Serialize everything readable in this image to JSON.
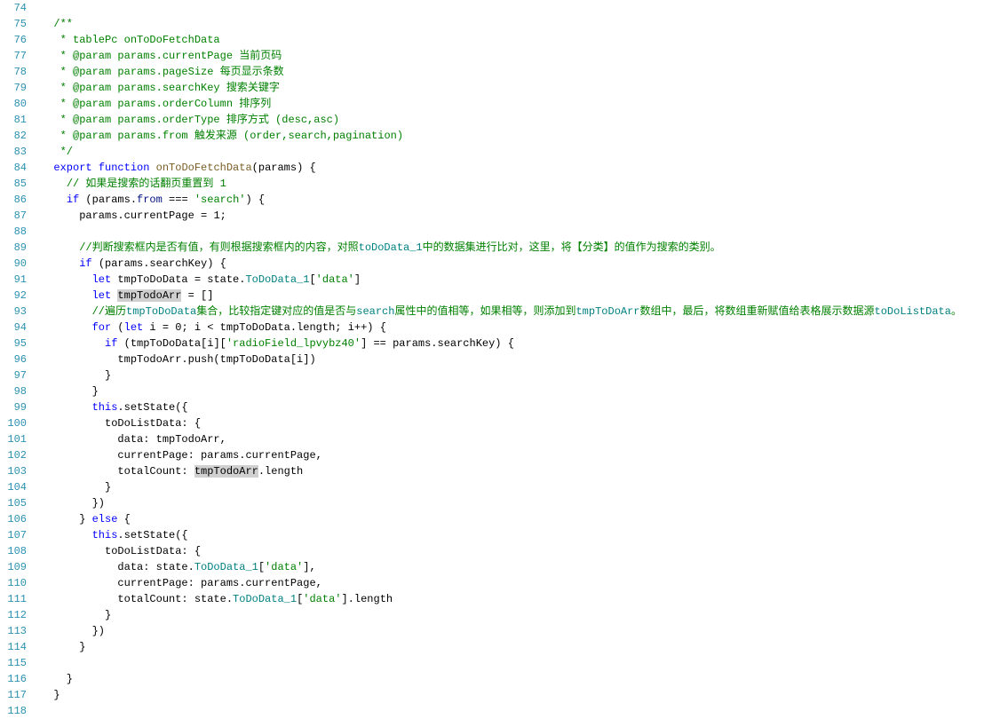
{
  "startLine": 74,
  "endLine": 118,
  "lines": [
    {
      "n": 74,
      "segs": []
    },
    {
      "n": 75,
      "segs": [
        {
          "t": "  ",
          "c": "plain"
        },
        {
          "t": "/**",
          "c": "comment"
        }
      ]
    },
    {
      "n": 76,
      "segs": [
        {
          "t": "   * tablePc onToDoFetchData",
          "c": "comment"
        }
      ]
    },
    {
      "n": 77,
      "segs": [
        {
          "t": "   * @param params.currentPage 当前页码",
          "c": "comment"
        }
      ]
    },
    {
      "n": 78,
      "segs": [
        {
          "t": "   * @param params.pageSize 每页显示条数",
          "c": "comment"
        }
      ]
    },
    {
      "n": 79,
      "segs": [
        {
          "t": "   * @param params.searchKey 搜索关键字",
          "c": "comment"
        }
      ]
    },
    {
      "n": 80,
      "segs": [
        {
          "t": "   * @param params.orderColumn 排序列",
          "c": "comment"
        }
      ]
    },
    {
      "n": 81,
      "segs": [
        {
          "t": "   * @param params.orderType 排序方式 (desc,asc)",
          "c": "comment"
        }
      ]
    },
    {
      "n": 82,
      "segs": [
        {
          "t": "   * @param params.from 触发来源 (order,search,pagination)",
          "c": "comment"
        }
      ]
    },
    {
      "n": 83,
      "segs": [
        {
          "t": "   */",
          "c": "comment"
        }
      ]
    },
    {
      "n": 84,
      "segs": [
        {
          "t": "  ",
          "c": "plain"
        },
        {
          "t": "export",
          "c": "keyword"
        },
        {
          "t": " ",
          "c": "plain"
        },
        {
          "t": "function",
          "c": "keyword"
        },
        {
          "t": " ",
          "c": "plain"
        },
        {
          "t": "onToDoFetchData",
          "c": "method"
        },
        {
          "t": "(params) {",
          "c": "plain"
        }
      ]
    },
    {
      "n": 85,
      "segs": [
        {
          "t": "    ",
          "c": "plain"
        },
        {
          "t": "// 如果是搜索的话翻页重置到 1",
          "c": "comment"
        }
      ]
    },
    {
      "n": 86,
      "segs": [
        {
          "t": "    ",
          "c": "plain"
        },
        {
          "t": "if",
          "c": "keyword"
        },
        {
          "t": " (params.",
          "c": "plain"
        },
        {
          "t": "from",
          "c": "ident"
        },
        {
          "t": " === ",
          "c": "plain"
        },
        {
          "t": "'search'",
          "c": "string-green"
        },
        {
          "t": ") {",
          "c": "plain"
        }
      ]
    },
    {
      "n": 87,
      "segs": [
        {
          "t": "      params.currentPage = ",
          "c": "plain"
        },
        {
          "t": "1",
          "c": "plain"
        },
        {
          "t": ";",
          "c": "plain"
        }
      ]
    },
    {
      "n": 88,
      "segs": []
    },
    {
      "n": 89,
      "segs": [
        {
          "t": "      ",
          "c": "plain"
        },
        {
          "t": "//判断搜索框内是否有值，有则根据搜索框内的内容，对照",
          "c": "comment"
        },
        {
          "t": "toDoData_1",
          "c": "teal-ref"
        },
        {
          "t": "中的数据集进行比对，这里，将【分类】的值作为搜索的类别。",
          "c": "comment"
        }
      ]
    },
    {
      "n": 90,
      "segs": [
        {
          "t": "      ",
          "c": "plain"
        },
        {
          "t": "if",
          "c": "keyword"
        },
        {
          "t": " (params.searchKey) {",
          "c": "plain"
        }
      ]
    },
    {
      "n": 91,
      "segs": [
        {
          "t": "        ",
          "c": "plain"
        },
        {
          "t": "let",
          "c": "keyword"
        },
        {
          "t": " tmpToDoData = state.",
          "c": "plain"
        },
        {
          "t": "ToDoData_1",
          "c": "teal-ref"
        },
        {
          "t": "[",
          "c": "plain"
        },
        {
          "t": "'data'",
          "c": "string-green"
        },
        {
          "t": "]",
          "c": "plain"
        }
      ]
    },
    {
      "n": 92,
      "segs": [
        {
          "t": "        ",
          "c": "plain"
        },
        {
          "t": "let",
          "c": "keyword"
        },
        {
          "t": " ",
          "c": "plain"
        },
        {
          "t": "tmpTodoArr",
          "c": "highlight"
        },
        {
          "t": " = []",
          "c": "plain"
        }
      ]
    },
    {
      "n": 93,
      "segs": [
        {
          "t": "        ",
          "c": "plain"
        },
        {
          "t": "//遍历",
          "c": "comment"
        },
        {
          "t": "tmpToDoData",
          "c": "teal-ref"
        },
        {
          "t": "集合，比较指定键对应的值是否与",
          "c": "comment"
        },
        {
          "t": "search",
          "c": "teal-ref"
        },
        {
          "t": "属性中的值相等，如果相等，则添加到",
          "c": "comment"
        },
        {
          "t": "tmpToDoArr",
          "c": "teal-ref"
        },
        {
          "t": "数组中，最后，将数组重新赋值给表格展示数据源",
          "c": "comment"
        },
        {
          "t": "toDoListData",
          "c": "teal-ref"
        },
        {
          "t": "。",
          "c": "comment"
        }
      ]
    },
    {
      "n": 94,
      "segs": [
        {
          "t": "        ",
          "c": "plain"
        },
        {
          "t": "for",
          "c": "keyword"
        },
        {
          "t": " (",
          "c": "plain"
        },
        {
          "t": "let",
          "c": "keyword"
        },
        {
          "t": " i = ",
          "c": "plain"
        },
        {
          "t": "0",
          "c": "plain"
        },
        {
          "t": "; i < tmpToDoData.length; i++) {",
          "c": "plain"
        }
      ]
    },
    {
      "n": 95,
      "segs": [
        {
          "t": "          ",
          "c": "plain"
        },
        {
          "t": "if",
          "c": "keyword"
        },
        {
          "t": " (tmpToDoData[i][",
          "c": "plain"
        },
        {
          "t": "'radioField_lpvybz40'",
          "c": "string-green"
        },
        {
          "t": "] == params.searchKey) {",
          "c": "plain"
        }
      ]
    },
    {
      "n": 96,
      "segs": [
        {
          "t": "            tmpTodoArr.push(tmpToDoData[i])",
          "c": "plain"
        }
      ]
    },
    {
      "n": 97,
      "segs": [
        {
          "t": "          }",
          "c": "plain"
        }
      ]
    },
    {
      "n": 98,
      "segs": [
        {
          "t": "        }",
          "c": "plain"
        }
      ]
    },
    {
      "n": 99,
      "segs": [
        {
          "t": "        ",
          "c": "plain"
        },
        {
          "t": "this",
          "c": "keyword"
        },
        {
          "t": ".setState({",
          "c": "plain"
        }
      ]
    },
    {
      "n": 100,
      "segs": [
        {
          "t": "          toDoListData: {",
          "c": "plain"
        }
      ]
    },
    {
      "n": 101,
      "segs": [
        {
          "t": "            data: tmpTodoArr,",
          "c": "plain"
        }
      ]
    },
    {
      "n": 102,
      "segs": [
        {
          "t": "            currentPage: params.currentPage,",
          "c": "plain"
        }
      ]
    },
    {
      "n": 103,
      "segs": [
        {
          "t": "            totalCount: ",
          "c": "plain"
        },
        {
          "t": "tmpTodoArr",
          "c": "highlight"
        },
        {
          "t": ".length",
          "c": "plain"
        }
      ]
    },
    {
      "n": 104,
      "segs": [
        {
          "t": "          }",
          "c": "plain"
        }
      ]
    },
    {
      "n": 105,
      "segs": [
        {
          "t": "        })",
          "c": "plain"
        }
      ]
    },
    {
      "n": 106,
      "segs": [
        {
          "t": "      } ",
          "c": "plain"
        },
        {
          "t": "else",
          "c": "keyword"
        },
        {
          "t": " {",
          "c": "plain"
        }
      ]
    },
    {
      "n": 107,
      "segs": [
        {
          "t": "        ",
          "c": "plain"
        },
        {
          "t": "this",
          "c": "keyword"
        },
        {
          "t": ".setState({",
          "c": "plain"
        }
      ]
    },
    {
      "n": 108,
      "segs": [
        {
          "t": "          toDoListData: {",
          "c": "plain"
        }
      ]
    },
    {
      "n": 109,
      "segs": [
        {
          "t": "            data: state.",
          "c": "plain"
        },
        {
          "t": "ToDoData_1",
          "c": "teal-ref"
        },
        {
          "t": "[",
          "c": "plain"
        },
        {
          "t": "'data'",
          "c": "string-green"
        },
        {
          "t": "],",
          "c": "plain"
        }
      ]
    },
    {
      "n": 110,
      "segs": [
        {
          "t": "            currentPage: params.currentPage,",
          "c": "plain"
        }
      ]
    },
    {
      "n": 111,
      "segs": [
        {
          "t": "            totalCount: state.",
          "c": "plain"
        },
        {
          "t": "ToDoData_1",
          "c": "teal-ref"
        },
        {
          "t": "[",
          "c": "plain"
        },
        {
          "t": "'data'",
          "c": "string-green"
        },
        {
          "t": "].length",
          "c": "plain"
        }
      ]
    },
    {
      "n": 112,
      "segs": [
        {
          "t": "          }",
          "c": "plain"
        }
      ]
    },
    {
      "n": 113,
      "segs": [
        {
          "t": "        })",
          "c": "plain"
        }
      ]
    },
    {
      "n": 114,
      "segs": [
        {
          "t": "      }",
          "c": "plain"
        }
      ]
    },
    {
      "n": 115,
      "segs": []
    },
    {
      "n": 116,
      "segs": [
        {
          "t": "    }",
          "c": "plain"
        }
      ]
    },
    {
      "n": 117,
      "segs": [
        {
          "t": "  }",
          "c": "plain"
        }
      ]
    },
    {
      "n": 118,
      "segs": []
    }
  ]
}
